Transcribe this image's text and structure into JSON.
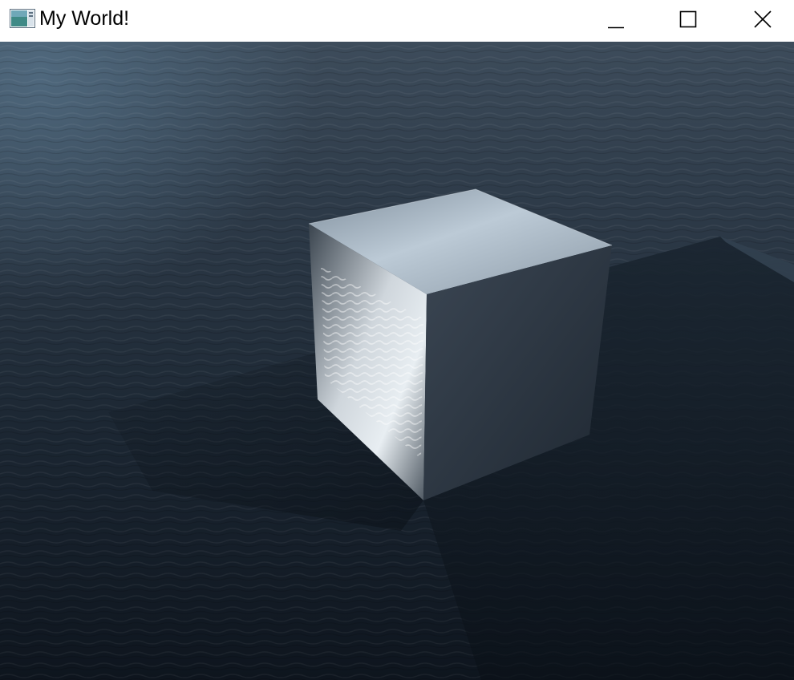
{
  "window": {
    "title": "My World!",
    "icon": "app-window-icon",
    "controls": {
      "minimize_icon": "minimize-icon",
      "maximize_icon": "maximize-icon",
      "close_icon": "close-icon"
    }
  },
  "scene": {
    "description_icons": [
      "ocean-water",
      "reflective-cube",
      "shadow"
    ],
    "colors": {
      "sea_top": "#3b4a5a",
      "sea_mid": "#243140",
      "sea_bottom": "#0f1721",
      "cube_top": "#a9b7c6",
      "cube_left": "#c7cfd6",
      "cube_right": "#2e3945"
    }
  }
}
